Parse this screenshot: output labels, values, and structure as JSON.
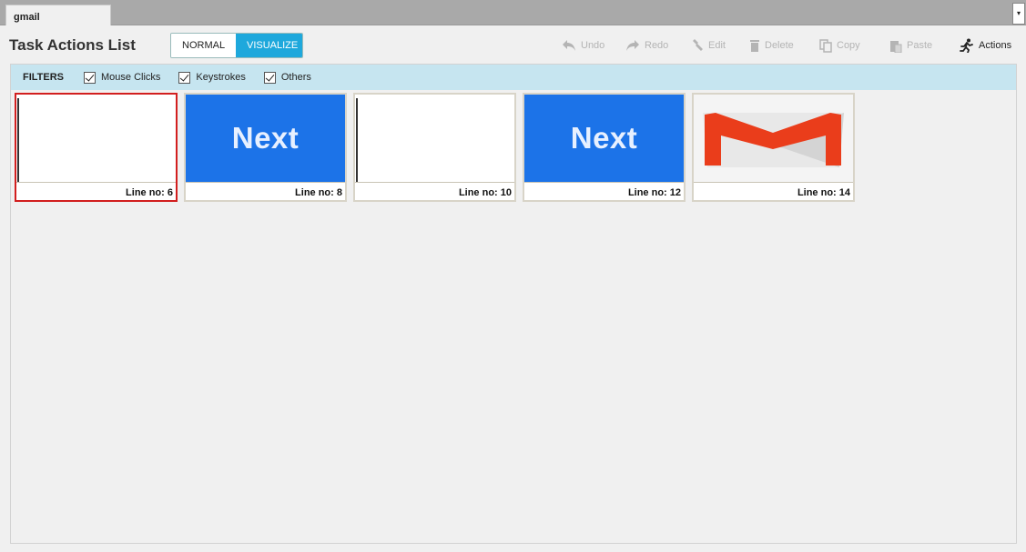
{
  "tab": {
    "label": "gmail",
    "dropdown_icon": "▾"
  },
  "page_title": "Task Actions List",
  "mode_toggle": {
    "normal_label": "NORMAL",
    "visualize_label": "VISUALIZE",
    "active": "VISUALIZE"
  },
  "toolbar": {
    "undo": "Undo",
    "redo": "Redo",
    "edit": "Edit",
    "delete": "Delete",
    "copy": "Copy",
    "paste": "Paste",
    "actions": "Actions"
  },
  "filters": {
    "label": "FILTERS",
    "items": [
      {
        "label": "Mouse Clicks",
        "checked": true
      },
      {
        "label": "Keystrokes",
        "checked": true
      },
      {
        "label": "Others",
        "checked": true
      }
    ]
  },
  "cards": [
    {
      "line": "Line no: 6",
      "thumb_type": "blank",
      "selected": true
    },
    {
      "line": "Line no: 8",
      "thumb_type": "next-button",
      "thumb_text": "Next"
    },
    {
      "line": "Line no: 10",
      "thumb_type": "blank"
    },
    {
      "line": "Line no: 12",
      "thumb_type": "next-button",
      "thumb_text": "Next"
    },
    {
      "line": "Line no: 14",
      "thumb_type": "gmail-logo"
    }
  ],
  "colors": {
    "accent": "#1ea8dc",
    "filter_bar": "#c6e5f0",
    "selection": "#d21e1e",
    "next_button": "#1c73e8",
    "gmail_red": "#ea3d1b"
  }
}
